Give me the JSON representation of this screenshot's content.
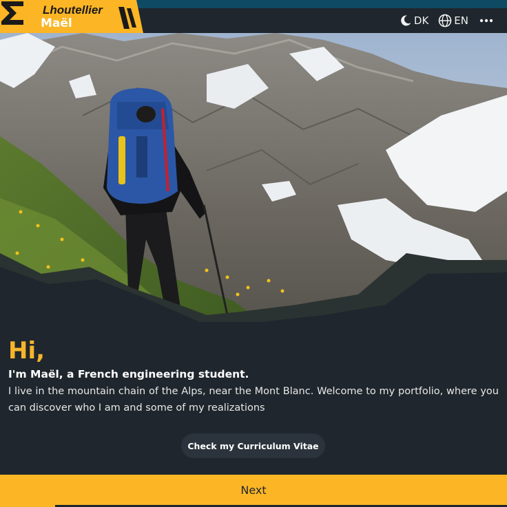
{
  "brand": {
    "first_name": "Lhoutellier",
    "last_name": "Maël",
    "sigma_symbol": "Σ",
    "accent_color": "#fbb525"
  },
  "header": {
    "theme_toggle": {
      "icon": "moon-icon",
      "label": "DK"
    },
    "language_toggle": {
      "icon": "globe-icon",
      "label": "EN"
    },
    "more_menu": {
      "icon": "more-dots-icon"
    }
  },
  "hero": {
    "image": "hiker-in-alps"
  },
  "intro": {
    "greeting": "Hi,",
    "subtitle": "I'm Maël, a French engineering student.",
    "description": "I live in the mountain chain of the Alps, near the Mont Blanc. Welcome to my portfolio, where you can discover who I am and some of my realizations"
  },
  "actions": {
    "cv_button_label": "Check my Curriculum Vitae",
    "next_label": "Next"
  },
  "colors": {
    "background": "#1f262d",
    "top_strip": "#0f4a63",
    "greeting": "#f7b52a"
  }
}
